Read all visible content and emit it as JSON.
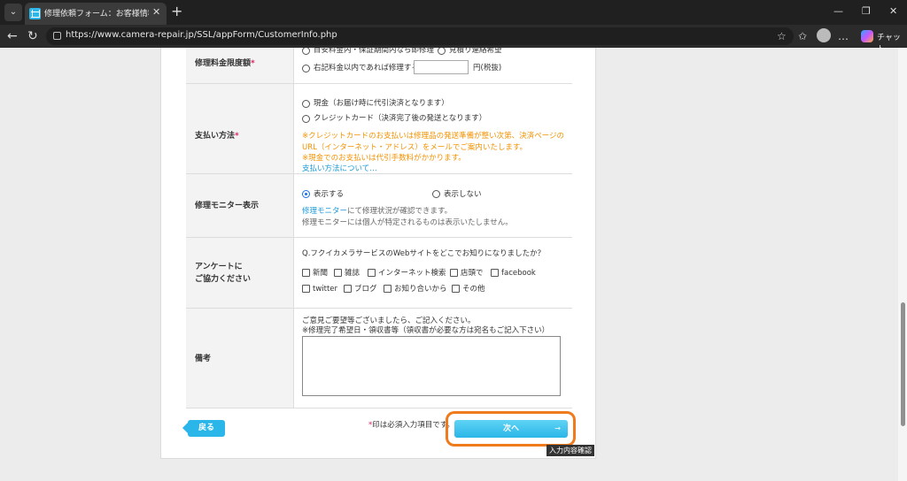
{
  "browser": {
    "tab_title": "修理依頼フォーム：お客様情報入力",
    "url": "https://www.camera-repair.jp/SSL/appForm/CustomerInfo.php",
    "copilot_label": "チャット"
  },
  "form": {
    "price_limit": {
      "label": "修理料金限度額",
      "required_mark": "*",
      "option_1": "目安料金内・保証期間内なら即修理",
      "option_2": "見積り連絡希望",
      "option_3": "右記料金以内であれば修理する",
      "amount_value": "",
      "suffix": "円(税抜)"
    },
    "payment": {
      "label": "支払い方法",
      "required_mark": "*",
      "option_cash": "現金（お届け時に代引決済となります）",
      "option_card": "クレジットカード（決済完了後の発送となります）",
      "note_1": "※クレジットカードのお支払いは修理品の発送準備が整い次第、決済ページの",
      "note_2": "URL（インターネット・アドレス）をメールでご案内いたします。",
      "note_3": "※現金でのお支払いは代引手数料がかかります。",
      "link": "支払い方法について…"
    },
    "monitor": {
      "label": "修理モニター表示",
      "option_show": "表示する",
      "option_hide": "表示しない",
      "info_link": "修理モニター",
      "info_rest": "にて修理状況が確認できます。",
      "info_2": "修理モニターには個人が特定されるものは表示いたしません。"
    },
    "survey": {
      "label_1": "アンケートに",
      "label_2": "ご協力ください",
      "question": "Q.フクイカメラサービスのWebサイトをどこでお知りになりましたか？",
      "options": [
        "新聞",
        "雑誌",
        "インターネット検索",
        "店頭で",
        "facebook",
        "twitter",
        "ブログ",
        "お知り合いから",
        "その他"
      ]
    },
    "remarks": {
      "label": "備考",
      "note_1": "ご意見ご要望等ございましたら、ご記入ください。",
      "note_2": "※修理完了希望日・領収書等（領収書が必要な方は宛名もご記入下さい）",
      "value": ""
    }
  },
  "footer": {
    "back_label": "戻る",
    "required_note_mark": "*",
    "required_note_text": "印は必須入力項目です。",
    "next_label": "次へ",
    "next_arrow": "→",
    "tooltip": "入力内容確認"
  },
  "colors": {
    "accent": "#2ab6e8",
    "highlight": "#f07b1d",
    "required": "#e0245e",
    "note": "#f39200"
  }
}
